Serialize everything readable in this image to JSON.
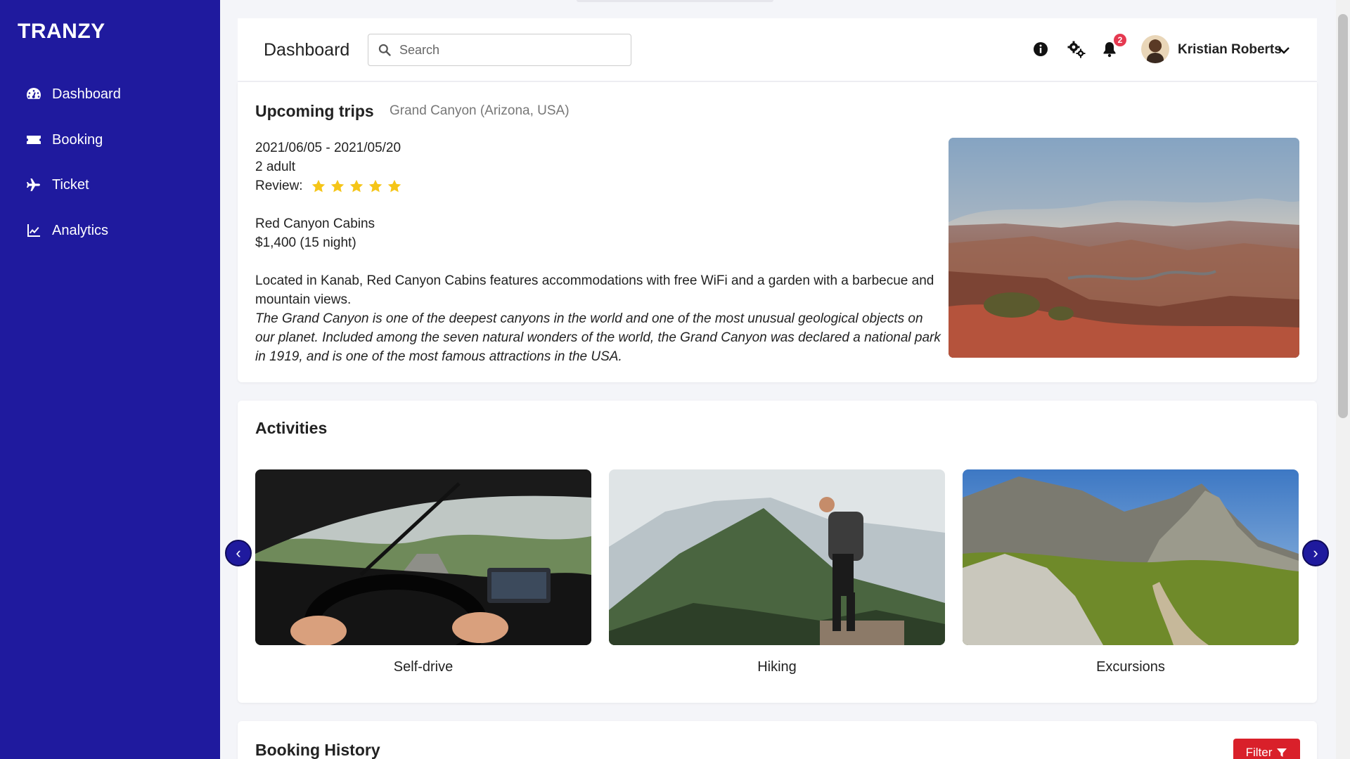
{
  "app": {
    "brand": "TRANZY"
  },
  "sidebar": {
    "items": [
      {
        "label": "Dashboard",
        "icon": "dashboard-gauge-icon"
      },
      {
        "label": "Booking",
        "icon": "ticket-icon"
      },
      {
        "label": "Ticket",
        "icon": "plane-icon"
      },
      {
        "label": "Analytics",
        "icon": "chart-line-icon"
      }
    ]
  },
  "header": {
    "title": "Dashboard",
    "search_placeholder": "Search",
    "notification_count": "2",
    "user_name": "Kristian Roberts",
    "icons": [
      "info-icon",
      "settings-gears-icon",
      "bell-icon",
      "chevron-down-icon"
    ]
  },
  "upcoming_trips": {
    "title": "Upcoming trips",
    "location": "Grand Canyon (Arizona, USA)",
    "dates": "2021/06/05 - 2021/05/20",
    "guests": "2 adult",
    "review_label": "Review:",
    "rating": 5,
    "accommodation": "Red Canyon Cabins",
    "price": "$1,400 (15 night)",
    "description": "Located in Kanab, Red Canyon Cabins features accommodations with free WiFi and a garden with a barbecue and mountain views.",
    "description_italic": "The Grand Canyon is one of the deepest canyons in the world and one of the most unusual geological objects on our planet. Included among the seven natural wonders of the world, the Grand Canyon was declared a national park in 1919, and is one of the most famous attractions in the USA."
  },
  "activities": {
    "title": "Activities",
    "items": [
      {
        "label": "Self-drive"
      },
      {
        "label": "Hiking"
      },
      {
        "label": "Excursions"
      }
    ],
    "prev_symbol": "‹",
    "next_symbol": "›"
  },
  "booking_history": {
    "title": "Booking History",
    "filter_label": "Filter"
  },
  "colors": {
    "sidebar": "#1f1a9e",
    "filter": "#d9202a",
    "star": "#f5c518",
    "badge": "#e53950"
  }
}
